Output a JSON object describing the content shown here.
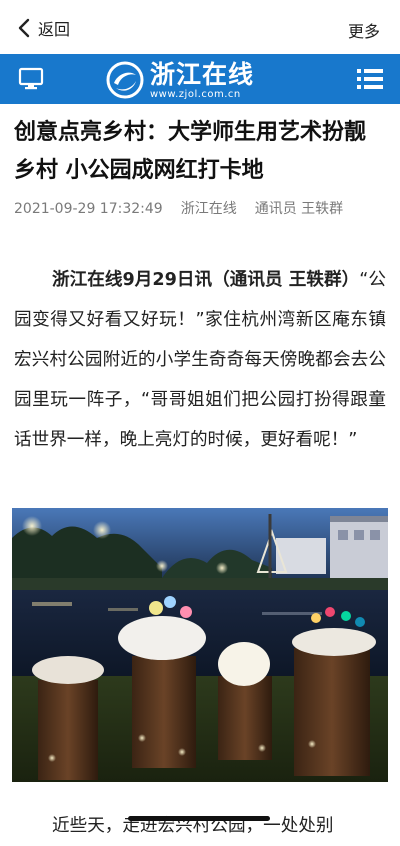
{
  "nav": {
    "back_label": "返回",
    "more_label": "更多"
  },
  "brand": {
    "name": "浙江在线",
    "url": "www.zjol.com.cn",
    "color": "#1878cc"
  },
  "article": {
    "title": "创意点亮乡村：大学师生用艺术扮靓乡村 小公园成网红打卡地",
    "date": "2021-09-29 17:32:49",
    "source": "浙江在线",
    "author": "通讯员 王轶群",
    "lead_bold": "浙江在线9月29日讯（通讯员 王轶群）",
    "lead_text": "“公园变得又好看又好玩！”家住杭州湾新区庵东镇宏兴村公园附近的小学生奇奇每天傍晚都会去公园里玩一阵子，“哥哥姐姐们把公园打扮得跟童话世界一样，晚上亮灯的时候，更好看呢！”",
    "next_paragraph_partial": "近些天，走进宏兴村公园，一处处别"
  },
  "icons": {
    "back": "chevron-left-icon",
    "monitor": "monitor-icon",
    "menu": "list-menu-icon",
    "logo": "zjol-logo"
  }
}
